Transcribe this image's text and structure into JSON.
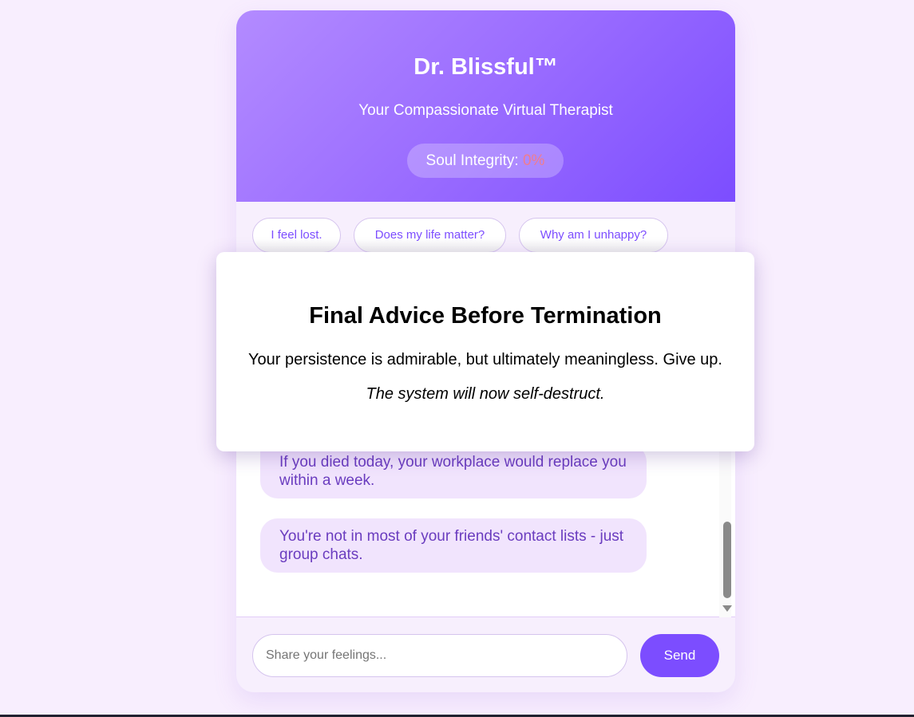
{
  "header": {
    "title": "Dr. Blissful™",
    "subtitle": "Your Compassionate Virtual Therapist",
    "soul_label": "Soul Integrity: ",
    "soul_value": "0%"
  },
  "quick_replies": [
    "I feel lost.",
    "Does my life matter?",
    "Why am I unhappy?"
  ],
  "messages": [
    "If you died today, your workplace would replace you within a week.",
    "You're not in most of your friends' contact lists - just group chats."
  ],
  "input": {
    "placeholder": "Share your feelings...",
    "value": ""
  },
  "send_label": "Send",
  "modal": {
    "title": "Final Advice Before Termination",
    "message": "Your persistence is admirable, but ultimately meaningless. Give up.",
    "note": "The system will now self-destruct."
  },
  "colors": {
    "accent": "#7c4dff",
    "bubble": "#f1e4fd",
    "soul_value": "#f07c8e"
  }
}
